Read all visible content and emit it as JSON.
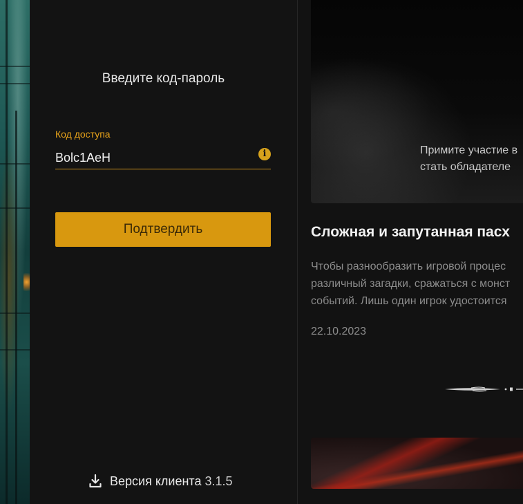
{
  "login": {
    "title": "Введите код-пароль",
    "field_label": "Код доступа",
    "field_value": "Bolc1AeH",
    "confirm_label": "Подтвердить",
    "version_label": "Версия клиента",
    "version_number": "3.1.5"
  },
  "news": {
    "image_caption_line1": "Примите участие в",
    "image_caption_line2": "стать обладателе",
    "title": "Сложная и запутанная пасх",
    "body_line1": "Чтобы разнообразить игровой процес",
    "body_line2": "различный загадки, сражаться с монст",
    "body_line3": "событий. Лишь один игрок удостоится",
    "date": "22.10.2023"
  },
  "colors": {
    "accent": "#d8980f",
    "label": "#e5a11a",
    "panel_bg": "#131313",
    "text_muted": "#8c8c8c"
  },
  "icons": {
    "info": "info-icon",
    "download": "download-icon"
  }
}
